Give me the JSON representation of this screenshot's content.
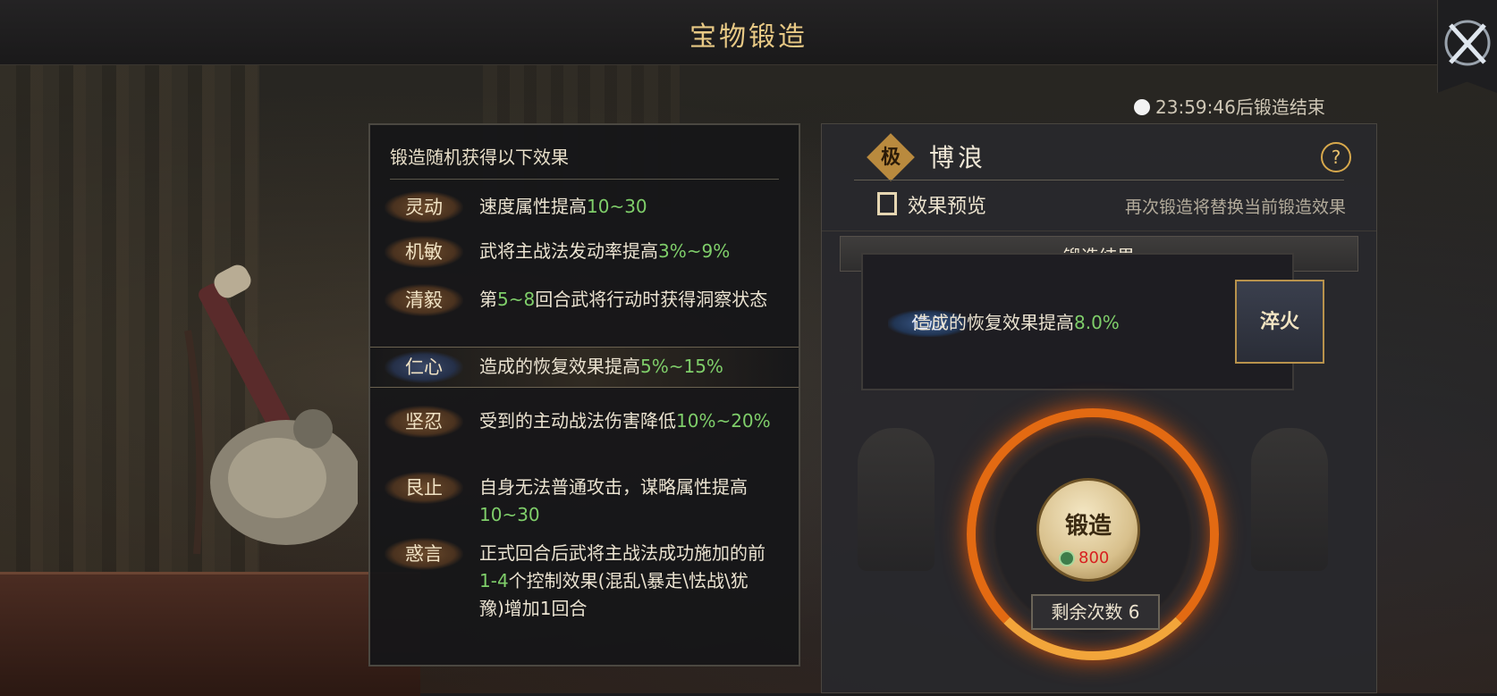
{
  "header": {
    "title": "宝物锻造"
  },
  "timer": {
    "text": "23:59:46后锻造结束"
  },
  "effects_panel": {
    "title": "锻造随机获得以下效果",
    "items": [
      {
        "tag": "灵动",
        "pre": "速度属性提高",
        "val": "10~30",
        "post": ""
      },
      {
        "tag": "机敏",
        "pre": "武将主战法发动率提高",
        "val": "3%~9%",
        "post": ""
      },
      {
        "tag": "清毅",
        "pre": "第",
        "val": "5~8",
        "post": "回合武将行动时获得洞察状态"
      },
      {
        "tag": "仁心",
        "pre": "造成的恢复效果提高",
        "val": "5%~15%",
        "post": ""
      },
      {
        "tag": "坚忍",
        "pre": "受到的主动战法伤害降低",
        "val": "10%~20%",
        "post": ""
      },
      {
        "tag": "艮止",
        "pre": "自身无法普通攻击，谋略属性提高",
        "val": "10~30",
        "post": ""
      },
      {
        "tag": "惑言",
        "pre": "正式回合后武将主战法成功施加的前",
        "val": "1-4",
        "post": "个控制效果(混乱\\暴走\\怯战\\犹豫)增加1回合"
      }
    ]
  },
  "forge_panel": {
    "quality_icon": "极",
    "treasure_name": "博浪",
    "help_label": "?",
    "preview_label": "效果预览",
    "replace_note": "再次锻造将替换当前锻造效果",
    "result_header": "锻造结果",
    "result": {
      "tag": "仁心",
      "pre": "造成的恢复效果提高",
      "val": "8.0%"
    },
    "temper_button": "淬火",
    "forge_button": "锻造",
    "cost": "800",
    "remaining": "剩余次数 6"
  },
  "colors": {
    "accent_gold": "#e8c985",
    "value_green": "#7fce6a",
    "cost_red": "#d81f1f",
    "ring_orange": "#e36a12"
  }
}
